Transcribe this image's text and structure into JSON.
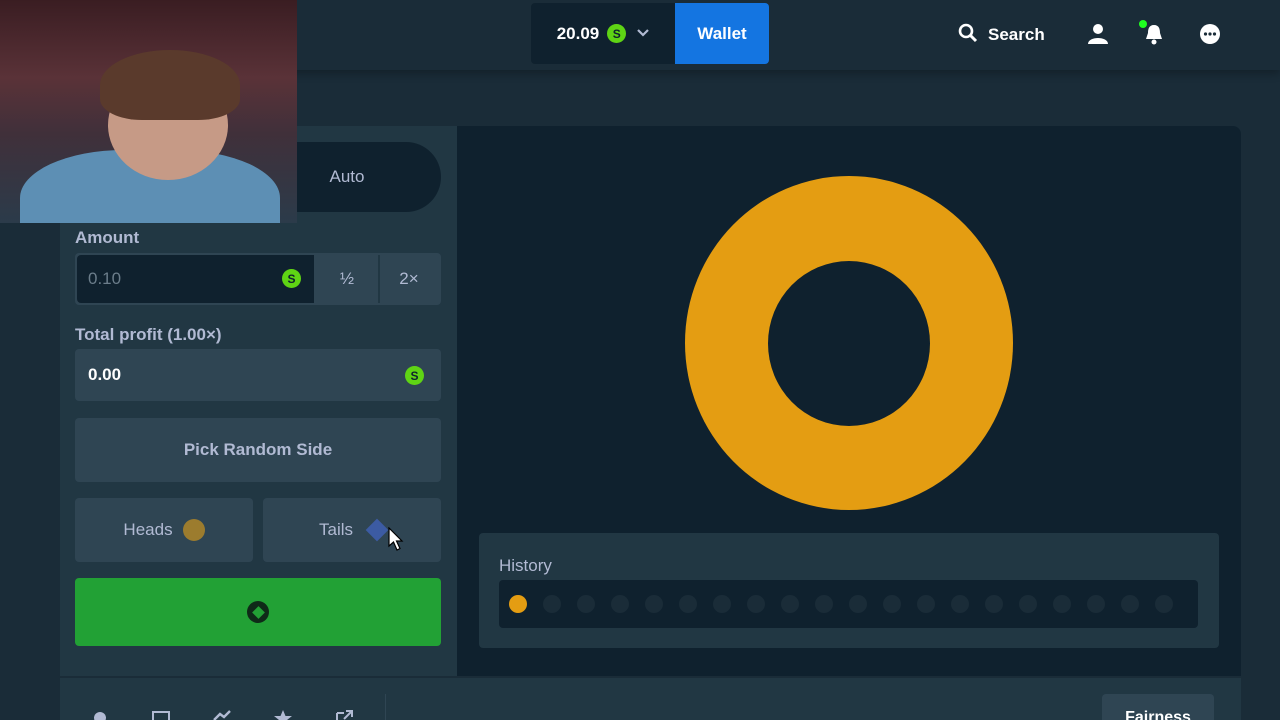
{
  "header": {
    "balance": "20.09",
    "currency_symbol": "S",
    "wallet_label": "Wallet",
    "search_label": "Search"
  },
  "mode_tabs": {
    "auto_label": "Auto"
  },
  "bet_panel": {
    "amount_label": "Amount",
    "amount_value": "0.10",
    "half_label": "½",
    "double_label": "2×",
    "profit_label": "Total profit (1.00×)",
    "profit_value": "0.00",
    "random_label": "Pick Random Side",
    "heads_label": "Heads",
    "tails_label": "Tails"
  },
  "history": {
    "title": "History",
    "results": [
      "heads"
    ]
  },
  "footer": {
    "fairness_label": "Fairness"
  },
  "colors": {
    "accent_gold": "#e49d12",
    "wallet_blue": "#1475e1",
    "bet_green": "#22a135",
    "currency_green": "#5fd414"
  }
}
